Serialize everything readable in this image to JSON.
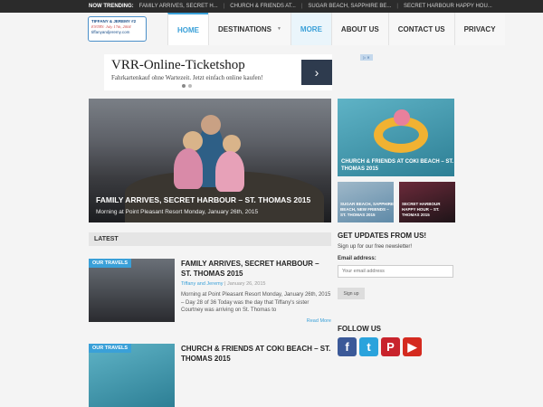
{
  "trending": {
    "label": "NOW TRENDING:",
    "items": [
      "FAMILY ARRIVES, SECRET H...",
      "CHURCH & FRIENDS AT...",
      "SUGAR BEACH, SAPPHIRE BE...",
      "SECRET HARBOUR HAPPY HOU..."
    ]
  },
  "logo": {
    "line1": "TIFFANY & JEREMY #2",
    "line2": "ENTRY: July 17th, 2004",
    "line3": "tiffanyandjeremy.com"
  },
  "nav": {
    "home": "HOME",
    "destinations": "DESTINATIONS",
    "more": "MORE",
    "about": "ABOUT US",
    "contact": "CONTACT US",
    "privacy": "PRIVACY"
  },
  "ad": {
    "title": "VRR-Online-Ticketshop",
    "subtitle": "Fahrkartenkauf ohne Wartezeit. Jetzt einfach online kaufen!",
    "arrow": "›"
  },
  "hero": {
    "title": "FAMILY ARRIVES, SECRET HARBOUR – ST. THOMAS 2015",
    "subtitle": "Morning at Point Pleasant Resort Monday, January 26th, 2015"
  },
  "side_big": {
    "title": "CHURCH & FRIENDS AT COKI BEACH – ST. THOMAS 2015"
  },
  "side_small": [
    {
      "title": "SUGAR BEACH, SAPPHIRE BEACH, NEW FRIENDS – ST. THOMAS 2015"
    },
    {
      "title": "SECRET HARBOUR HAPPY HOUR – ST. THOMAS 2015"
    }
  ],
  "latest": {
    "label": "LATEST"
  },
  "posts": [
    {
      "badge": "OUR TRAVELS",
      "title": "FAMILY ARRIVES, SECRET HARBOUR – ST. THOMAS 2015",
      "author": "Tiffany and Jeremy",
      "sep": "|",
      "date": "January 26, 2015",
      "excerpt": "Morning at Point Pleasant Resort Monday, January 26th, 2015 – Day 28 of 36 Today was the day that Tiffany's sister Courtney was arriving on St. Thomas to",
      "more": "Read More"
    },
    {
      "badge": "OUR TRAVELS",
      "title": "CHURCH & FRIENDS AT COKI BEACH – ST. THOMAS 2015"
    }
  ],
  "sidebar": {
    "updates_title": "GET UPDATES FROM US!",
    "updates_text": "Sign up for our free newsletter!",
    "email_label": "Email address:",
    "email_placeholder": "Your email address",
    "signup": "Sign up",
    "follow_title": "FOLLOW US",
    "social": [
      {
        "name": "facebook-icon",
        "glyph": "f",
        "color": "#3b5998"
      },
      {
        "name": "twitter-icon",
        "glyph": "t",
        "color": "#2aa3dc"
      },
      {
        "name": "pinterest-icon",
        "glyph": "P",
        "color": "#c8232c"
      },
      {
        "name": "youtube-icon",
        "glyph": "▶",
        "color": "#d42a1f"
      }
    ]
  }
}
